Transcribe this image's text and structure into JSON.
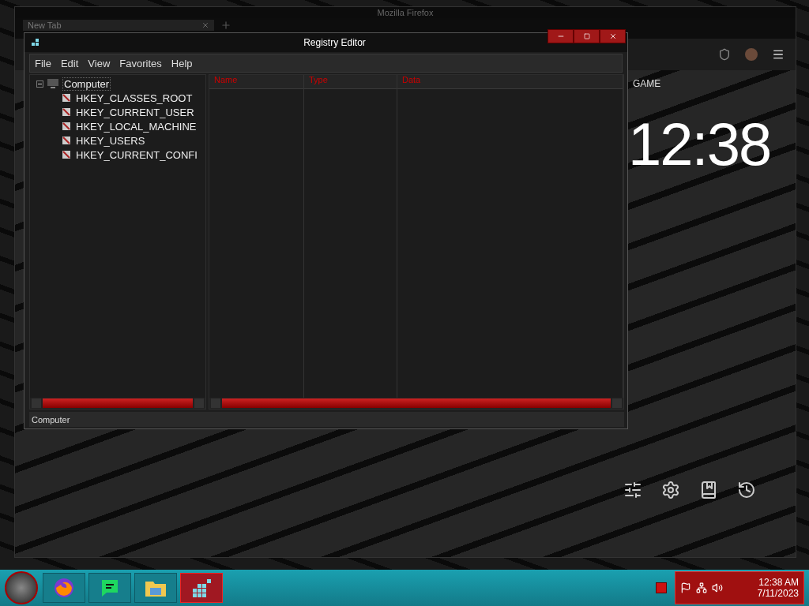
{
  "browser": {
    "title": "Mozilla Firefox",
    "tab": "New Tab",
    "partial_label": "GAME",
    "clock": "12:38"
  },
  "registry_editor": {
    "title": "Registry Editor",
    "menu": [
      "File",
      "Edit",
      "View",
      "Favorites",
      "Help"
    ],
    "tree": {
      "label": "Computer",
      "expanded": true,
      "selected": true,
      "children": [
        {
          "label": "HKEY_CLASSES_ROOT",
          "selected": false
        },
        {
          "label": "HKEY_CURRENT_USER",
          "selected": false
        },
        {
          "label": "HKEY_LOCAL_MACHINE",
          "selected": false
        },
        {
          "label": "HKEY_USERS",
          "selected": false
        },
        {
          "label": "HKEY_CURRENT_CONFI",
          "selected": false
        }
      ]
    },
    "columns": [
      "Name",
      "Type",
      "Data"
    ],
    "status_bar": "Computer"
  },
  "taskbar": {
    "apps": [
      {
        "kind": "browser",
        "selected": false
      },
      {
        "kind": "notes",
        "selected": false
      },
      {
        "kind": "folder",
        "selected": false
      },
      {
        "kind": "registry",
        "selected": true
      }
    ],
    "time": "12:38 AM",
    "date": "7/11/2023"
  }
}
